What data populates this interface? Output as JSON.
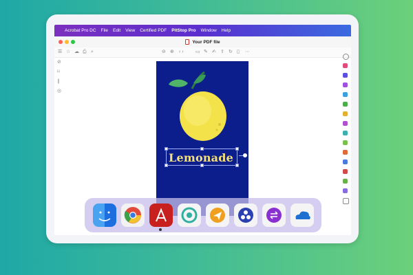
{
  "menubar": {
    "items": [
      "Acrobat Pro DC",
      "File",
      "Edit",
      "View",
      "Certified PDF",
      "PitStop Pro",
      "Window",
      "Help"
    ],
    "bold_item": "PitStop Pro"
  },
  "window": {
    "title": "Your PDF file"
  },
  "document": {
    "headline": "Lemonade"
  },
  "colors": {
    "page_bg": "#0b1e8c",
    "lemon": "#f3e24a",
    "headline": "#f6e07a",
    "menubar_gradient": [
      "#7b2fbf",
      "#3b6be0"
    ]
  },
  "toolbar": {
    "left_icons": [
      "sidebar-icon",
      "star-icon",
      "cloud-upload-icon",
      "print-icon",
      "search-icon"
    ],
    "center_icons": [
      "up-arrow-icon",
      "down-arrow-icon",
      "page-nav-icon",
      "comment-icon",
      "pen-icon",
      "signature-icon",
      "share-icon",
      "rotate-icon",
      "delete-icon",
      "more-icon"
    ]
  },
  "left_rail_icons": [
    "link-icon",
    "bookmark-icon",
    "attachment-icon",
    "layers-icon"
  ],
  "right_rail_icons": [
    "zoom-icon",
    "export-icon",
    "edit-pdf-icon",
    "organize-icon",
    "scan-icon",
    "comment-icon",
    "fill-sign-icon",
    "protect-icon",
    "print-production-icon",
    "compare-icon",
    "preflight-icon",
    "action-icon",
    "redact-icon",
    "accessibility-icon",
    "settings-icon",
    "plus-icon"
  ],
  "dock": {
    "apps": [
      {
        "name": "finder-icon"
      },
      {
        "name": "chrome-icon"
      },
      {
        "name": "acrobat-icon"
      },
      {
        "name": "pitstop-icon"
      },
      {
        "name": "paper-plane-icon"
      },
      {
        "name": "app-circle-icon"
      },
      {
        "name": "switch-icon"
      },
      {
        "name": "onedrive-icon"
      }
    ]
  }
}
